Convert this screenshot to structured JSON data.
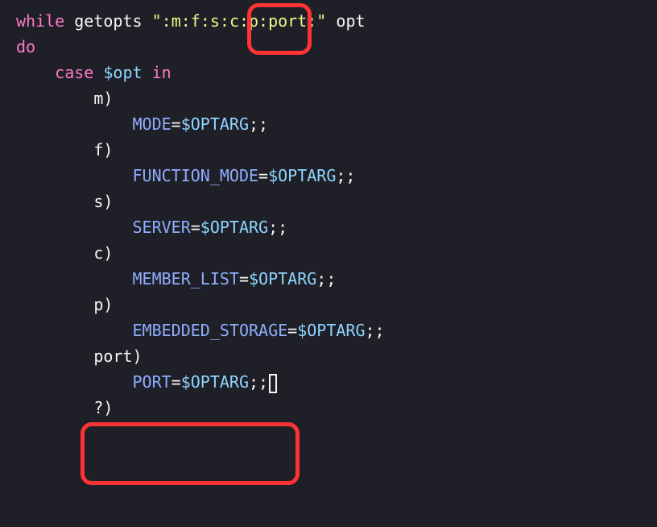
{
  "code": {
    "while_kw": "while",
    "getopts": "getopts",
    "optstring": "\":m:f:s:c:p:port:\"",
    "opt": "opt",
    "do_kw": "do",
    "case_kw": "case",
    "case_var": "$opt",
    "in_kw": "in",
    "case_m": "m)",
    "mode_var": "MODE",
    "eq": "=",
    "optarg": "$OPTARG",
    "dsemi": ";;",
    "case_f": "f)",
    "func_var": "FUNCTION_MODE",
    "case_s": "s)",
    "server_var": "SERVER",
    "case_c": "c)",
    "member_var": "MEMBER_LIST",
    "case_p": "p)",
    "embedded_var": "EMBEDDED_STORAGE",
    "case_port": "port)",
    "port_var": "PORT",
    "case_q": "?)"
  }
}
